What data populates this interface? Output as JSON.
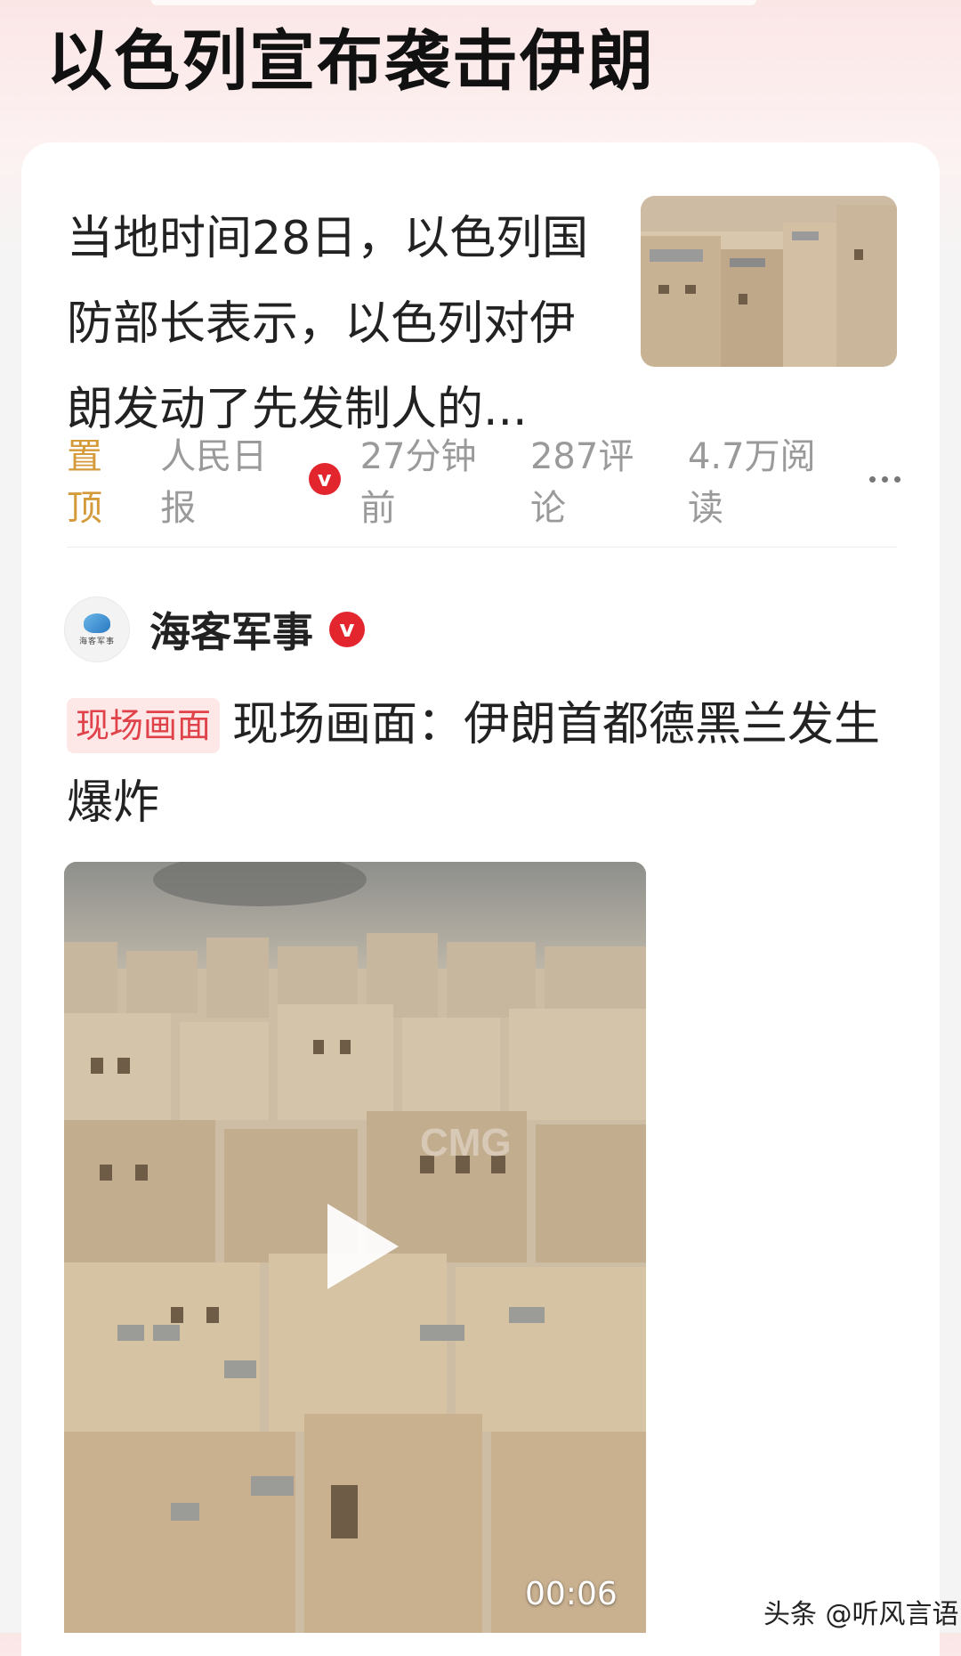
{
  "header": {
    "title": "以色列宣布袭击伊朗"
  },
  "story1": {
    "text": "当地时间28日，以色列国防部长表示，以色列对伊朗发动了先发制人的...",
    "meta": {
      "pinned": "置顶",
      "source": "人民日报",
      "verified": "v",
      "time": "27分钟前",
      "comments": "287评论",
      "reads": "4.7万阅读"
    }
  },
  "story2": {
    "author": "海客军事",
    "author_avatar_text": "海客军事",
    "verified": "v",
    "tag": "现场画面",
    "headline": "现场画面：伊朗首都德黑兰发生爆炸",
    "video": {
      "duration": "00:06",
      "watermark": "CMG"
    }
  },
  "footer": {
    "watermark": "头条 @听风言语"
  },
  "colors": {
    "accent_red": "#e3252d",
    "tag_bg": "#fde7e7",
    "pinned_gold": "#d59a3a"
  }
}
